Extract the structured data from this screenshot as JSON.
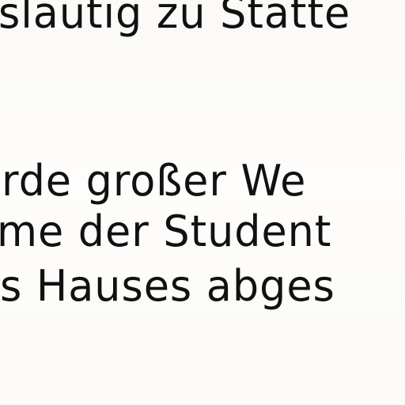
{
  "document": {
    "lines": [
      "släutig zu Stätte",
      "rde großer We",
      "me der Student",
      "s Hauses abges"
    ]
  }
}
